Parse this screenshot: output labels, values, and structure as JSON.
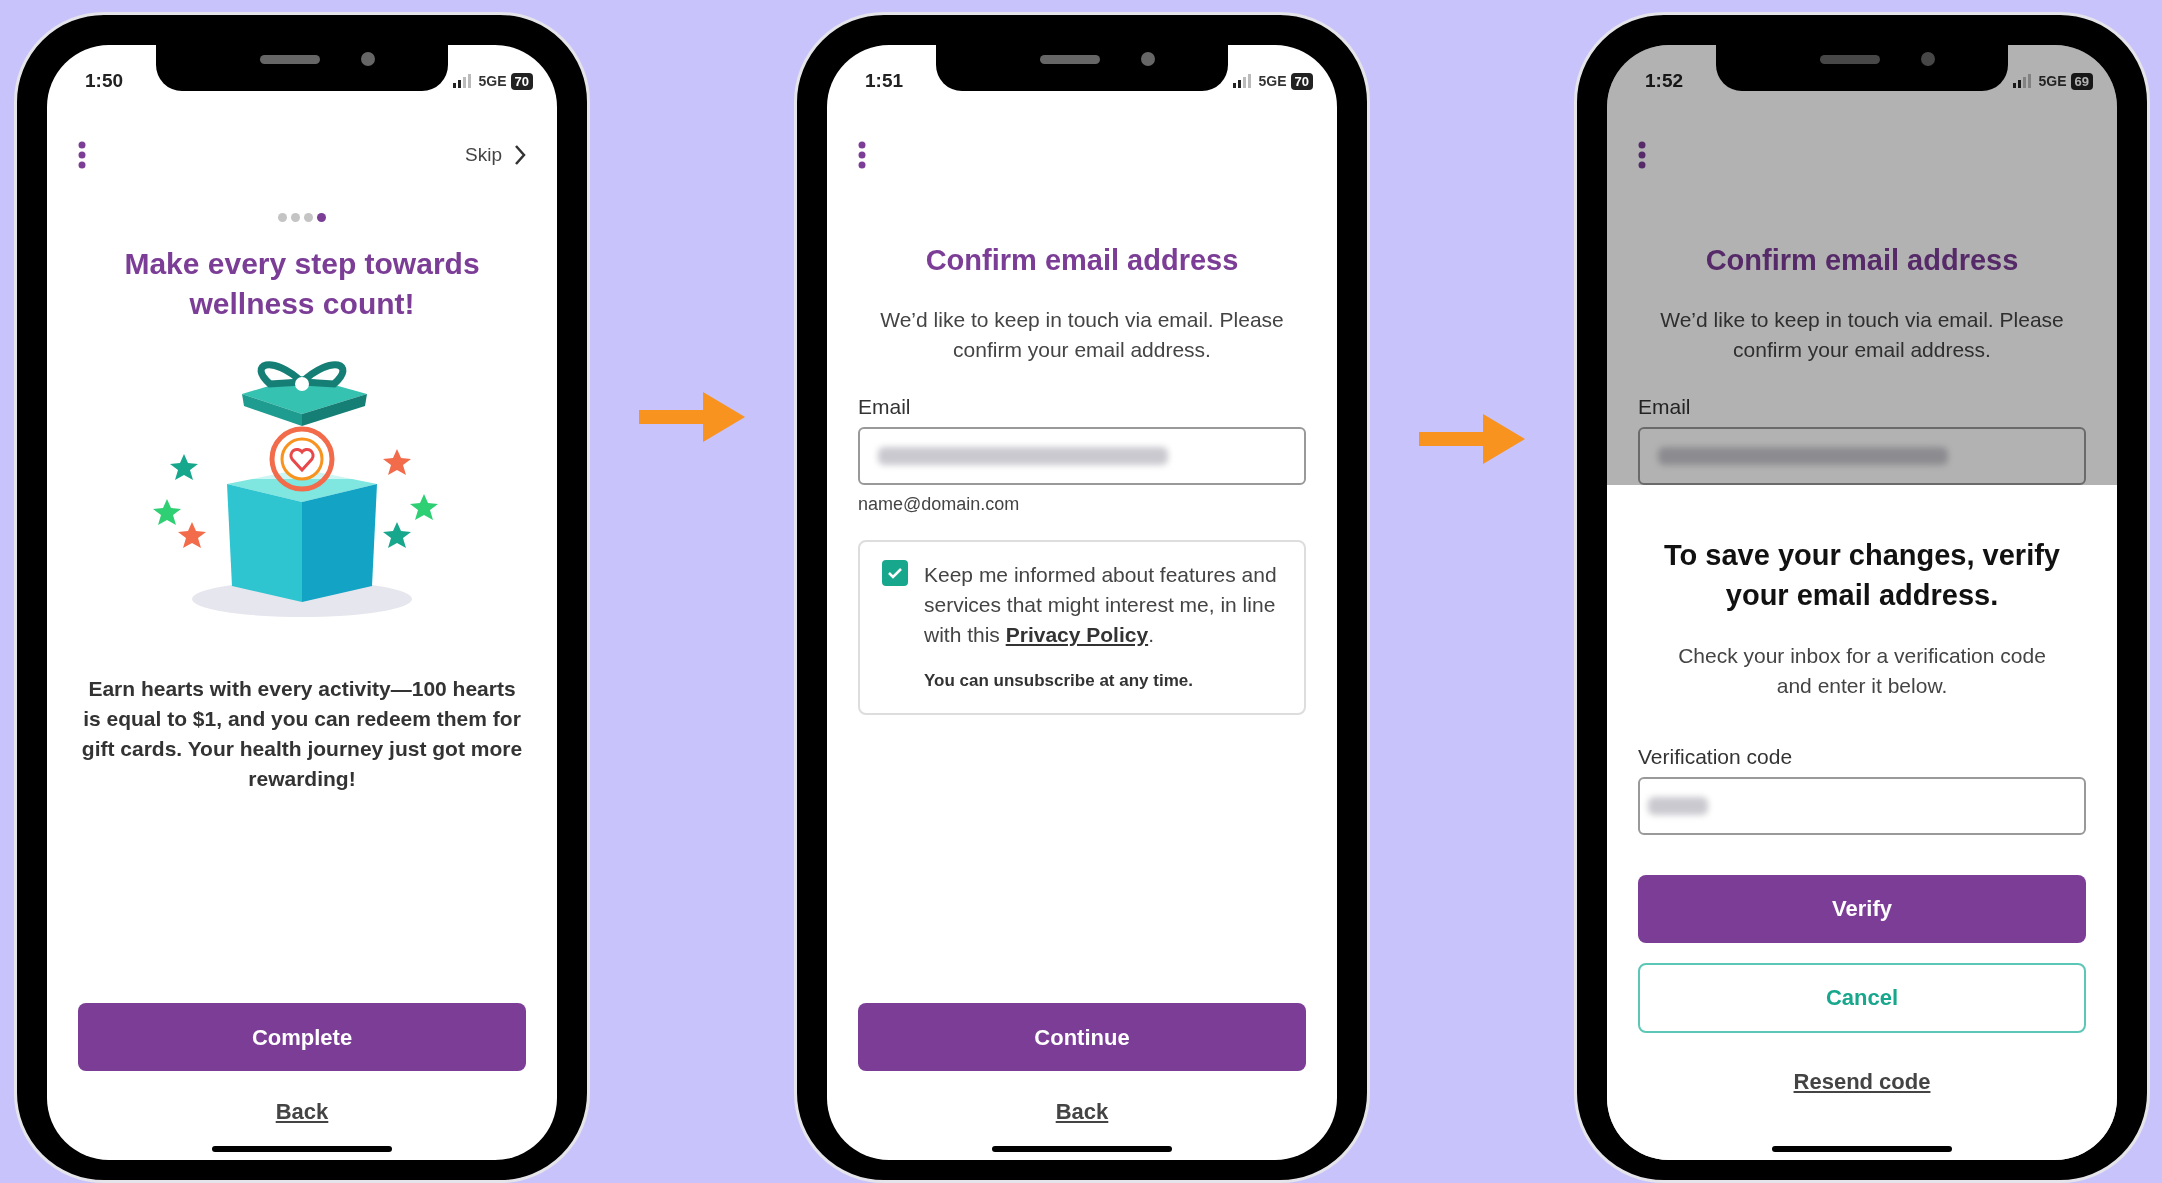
{
  "screens": [
    {
      "kind": "onboarding",
      "status_bar": {
        "time": "1:50",
        "network": "5GE",
        "battery": "70"
      },
      "skip": "Skip",
      "pager": [
        {
          "selected": false
        },
        {
          "selected": false
        },
        {
          "selected": false
        },
        {
          "selected": true
        }
      ],
      "title": "Make every step towards wellness count!",
      "body": "Earn hearts with every activity—100 hearts is equal to $1, and you can redeem them for gift cards. Your health journey just got more rewarding!",
      "primary_button": "Complete",
      "back_link": "Back"
    },
    {
      "kind": "email",
      "status_bar": {
        "time": "1:51",
        "network": "5GE",
        "battery": "70"
      },
      "title": "Confirm email address",
      "body": "We’d like to keep in touch via email. Please confirm your email address.",
      "email_label": "Email",
      "email_hint": "name@domain.com",
      "consent": {
        "checked": true,
        "text": "Keep me informed about features and services that might interest me, in line with this",
        "link": "Privacy Policy",
        "after": ".",
        "note": "You can unsubscribe at any time."
      },
      "primary_button": "Continue",
      "back_link": "Back"
    },
    {
      "kind": "verify",
      "status_bar": {
        "time": "1:52",
        "network": "5GE",
        "battery": "69"
      },
      "title": "Confirm email address",
      "body": "We’d like to keep in touch via email. Please confirm your email address.",
      "email_label": "Email",
      "sheet": {
        "title": "To save your changes, verify your email address.",
        "body": "Check your inbox for a verification code and enter it below.",
        "code_label": "Verification code",
        "verify_button": "Verify",
        "cancel_button": "Cancel",
        "resend_link": "Resend code"
      }
    }
  ]
}
